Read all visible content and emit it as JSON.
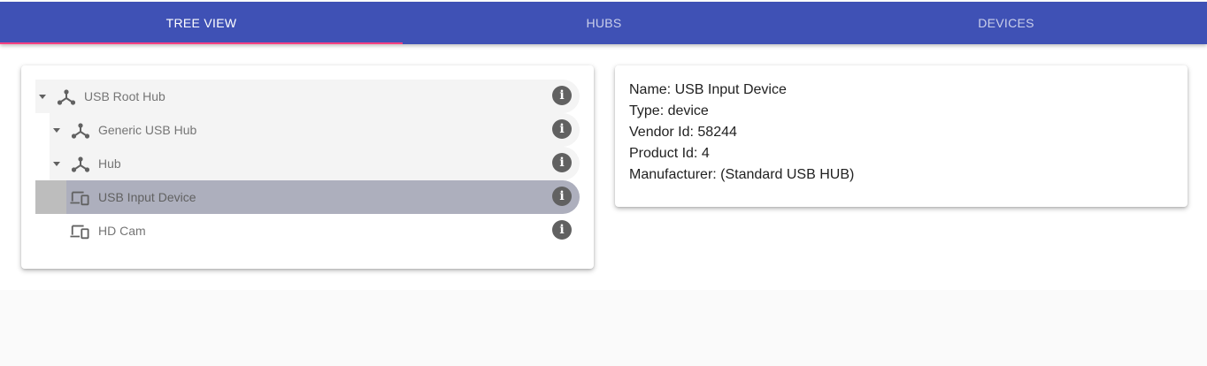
{
  "tabs": [
    {
      "label": "TREE VIEW",
      "active": true
    },
    {
      "label": "HUBS",
      "active": false
    },
    {
      "label": "DEVICES",
      "active": false
    }
  ],
  "tree": {
    "nodes": [
      {
        "label": "USB Root Hub",
        "icon": "usb-hub-icon",
        "expanded": true
      },
      {
        "label": "Generic USB Hub",
        "icon": "usb-hub-icon",
        "expanded": true
      },
      {
        "label": "Hub",
        "icon": "usb-hub-icon",
        "expanded": true
      },
      {
        "label": "USB Input Device",
        "icon": "devices-icon",
        "selected": true
      },
      {
        "label": "HD Cam",
        "icon": "devices-icon"
      }
    ],
    "info_glyph": "i"
  },
  "details": {
    "name": "Name: USB Input Device",
    "type": "Type: device",
    "vendor_id": "Vendor Id: 58244",
    "product_id": "Product Id: 4",
    "manufacturer": "Manufacturer: (Standard USB HUB)"
  },
  "colors": {
    "primary": "#3f51b5",
    "accent": "#ff4081",
    "selected_bg": "#adafbd",
    "expanded_bg": "#f4f4f4"
  }
}
